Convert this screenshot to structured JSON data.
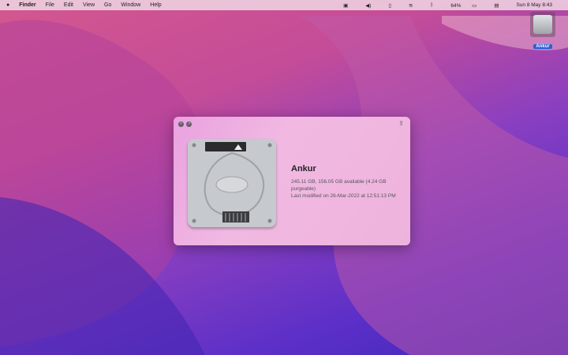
{
  "menubar": {
    "apple": "",
    "app": "Finder",
    "items": [
      "File",
      "Edit",
      "View",
      "Go",
      "Window",
      "Help"
    ],
    "status": {
      "battery": "64%",
      "datetime": "Sun 8 May  8:43"
    }
  },
  "desktop": {
    "icon_label": "Ankur"
  },
  "info_panel": {
    "name": "Ankur",
    "capacity": "245.11 GB, 156.05 GB available (4.24 GB purgeable)",
    "modified": "Last modified on 26-Mar-2022 at 12:51:13 PM"
  }
}
